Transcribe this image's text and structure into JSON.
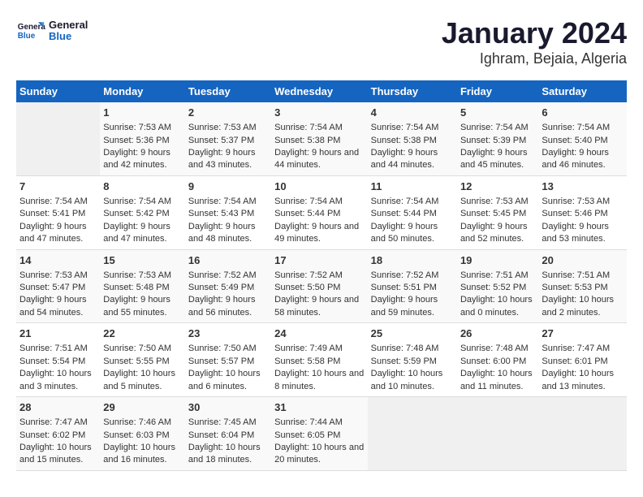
{
  "logo": {
    "text_general": "General",
    "text_blue": "Blue"
  },
  "title": "January 2024",
  "subtitle": "Ighram, Bejaia, Algeria",
  "weekdays": [
    "Sunday",
    "Monday",
    "Tuesday",
    "Wednesday",
    "Thursday",
    "Friday",
    "Saturday"
  ],
  "weeks": [
    [
      null,
      {
        "num": "1",
        "sunrise": "Sunrise: 7:53 AM",
        "sunset": "Sunset: 5:36 PM",
        "daylight": "Daylight: 9 hours and 42 minutes."
      },
      {
        "num": "2",
        "sunrise": "Sunrise: 7:53 AM",
        "sunset": "Sunset: 5:37 PM",
        "daylight": "Daylight: 9 hours and 43 minutes."
      },
      {
        "num": "3",
        "sunrise": "Sunrise: 7:54 AM",
        "sunset": "Sunset: 5:38 PM",
        "daylight": "Daylight: 9 hours and 44 minutes."
      },
      {
        "num": "4",
        "sunrise": "Sunrise: 7:54 AM",
        "sunset": "Sunset: 5:38 PM",
        "daylight": "Daylight: 9 hours and 44 minutes."
      },
      {
        "num": "5",
        "sunrise": "Sunrise: 7:54 AM",
        "sunset": "Sunset: 5:39 PM",
        "daylight": "Daylight: 9 hours and 45 minutes."
      },
      {
        "num": "6",
        "sunrise": "Sunrise: 7:54 AM",
        "sunset": "Sunset: 5:40 PM",
        "daylight": "Daylight: 9 hours and 46 minutes."
      }
    ],
    [
      {
        "num": "7",
        "sunrise": "Sunrise: 7:54 AM",
        "sunset": "Sunset: 5:41 PM",
        "daylight": "Daylight: 9 hours and 47 minutes."
      },
      {
        "num": "8",
        "sunrise": "Sunrise: 7:54 AM",
        "sunset": "Sunset: 5:42 PM",
        "daylight": "Daylight: 9 hours and 47 minutes."
      },
      {
        "num": "9",
        "sunrise": "Sunrise: 7:54 AM",
        "sunset": "Sunset: 5:43 PM",
        "daylight": "Daylight: 9 hours and 48 minutes."
      },
      {
        "num": "10",
        "sunrise": "Sunrise: 7:54 AM",
        "sunset": "Sunset: 5:44 PM",
        "daylight": "Daylight: 9 hours and 49 minutes."
      },
      {
        "num": "11",
        "sunrise": "Sunrise: 7:54 AM",
        "sunset": "Sunset: 5:44 PM",
        "daylight": "Daylight: 9 hours and 50 minutes."
      },
      {
        "num": "12",
        "sunrise": "Sunrise: 7:53 AM",
        "sunset": "Sunset: 5:45 PM",
        "daylight": "Daylight: 9 hours and 52 minutes."
      },
      {
        "num": "13",
        "sunrise": "Sunrise: 7:53 AM",
        "sunset": "Sunset: 5:46 PM",
        "daylight": "Daylight: 9 hours and 53 minutes."
      }
    ],
    [
      {
        "num": "14",
        "sunrise": "Sunrise: 7:53 AM",
        "sunset": "Sunset: 5:47 PM",
        "daylight": "Daylight: 9 hours and 54 minutes."
      },
      {
        "num": "15",
        "sunrise": "Sunrise: 7:53 AM",
        "sunset": "Sunset: 5:48 PM",
        "daylight": "Daylight: 9 hours and 55 minutes."
      },
      {
        "num": "16",
        "sunrise": "Sunrise: 7:52 AM",
        "sunset": "Sunset: 5:49 PM",
        "daylight": "Daylight: 9 hours and 56 minutes."
      },
      {
        "num": "17",
        "sunrise": "Sunrise: 7:52 AM",
        "sunset": "Sunset: 5:50 PM",
        "daylight": "Daylight: 9 hours and 58 minutes."
      },
      {
        "num": "18",
        "sunrise": "Sunrise: 7:52 AM",
        "sunset": "Sunset: 5:51 PM",
        "daylight": "Daylight: 9 hours and 59 minutes."
      },
      {
        "num": "19",
        "sunrise": "Sunrise: 7:51 AM",
        "sunset": "Sunset: 5:52 PM",
        "daylight": "Daylight: 10 hours and 0 minutes."
      },
      {
        "num": "20",
        "sunrise": "Sunrise: 7:51 AM",
        "sunset": "Sunset: 5:53 PM",
        "daylight": "Daylight: 10 hours and 2 minutes."
      }
    ],
    [
      {
        "num": "21",
        "sunrise": "Sunrise: 7:51 AM",
        "sunset": "Sunset: 5:54 PM",
        "daylight": "Daylight: 10 hours and 3 minutes."
      },
      {
        "num": "22",
        "sunrise": "Sunrise: 7:50 AM",
        "sunset": "Sunset: 5:55 PM",
        "daylight": "Daylight: 10 hours and 5 minutes."
      },
      {
        "num": "23",
        "sunrise": "Sunrise: 7:50 AM",
        "sunset": "Sunset: 5:57 PM",
        "daylight": "Daylight: 10 hours and 6 minutes."
      },
      {
        "num": "24",
        "sunrise": "Sunrise: 7:49 AM",
        "sunset": "Sunset: 5:58 PM",
        "daylight": "Daylight: 10 hours and 8 minutes."
      },
      {
        "num": "25",
        "sunrise": "Sunrise: 7:48 AM",
        "sunset": "Sunset: 5:59 PM",
        "daylight": "Daylight: 10 hours and 10 minutes."
      },
      {
        "num": "26",
        "sunrise": "Sunrise: 7:48 AM",
        "sunset": "Sunset: 6:00 PM",
        "daylight": "Daylight: 10 hours and 11 minutes."
      },
      {
        "num": "27",
        "sunrise": "Sunrise: 7:47 AM",
        "sunset": "Sunset: 6:01 PM",
        "daylight": "Daylight: 10 hours and 13 minutes."
      }
    ],
    [
      {
        "num": "28",
        "sunrise": "Sunrise: 7:47 AM",
        "sunset": "Sunset: 6:02 PM",
        "daylight": "Daylight: 10 hours and 15 minutes."
      },
      {
        "num": "29",
        "sunrise": "Sunrise: 7:46 AM",
        "sunset": "Sunset: 6:03 PM",
        "daylight": "Daylight: 10 hours and 16 minutes."
      },
      {
        "num": "30",
        "sunrise": "Sunrise: 7:45 AM",
        "sunset": "Sunset: 6:04 PM",
        "daylight": "Daylight: 10 hours and 18 minutes."
      },
      {
        "num": "31",
        "sunrise": "Sunrise: 7:44 AM",
        "sunset": "Sunset: 6:05 PM",
        "daylight": "Daylight: 10 hours and 20 minutes."
      },
      null,
      null,
      null
    ]
  ]
}
